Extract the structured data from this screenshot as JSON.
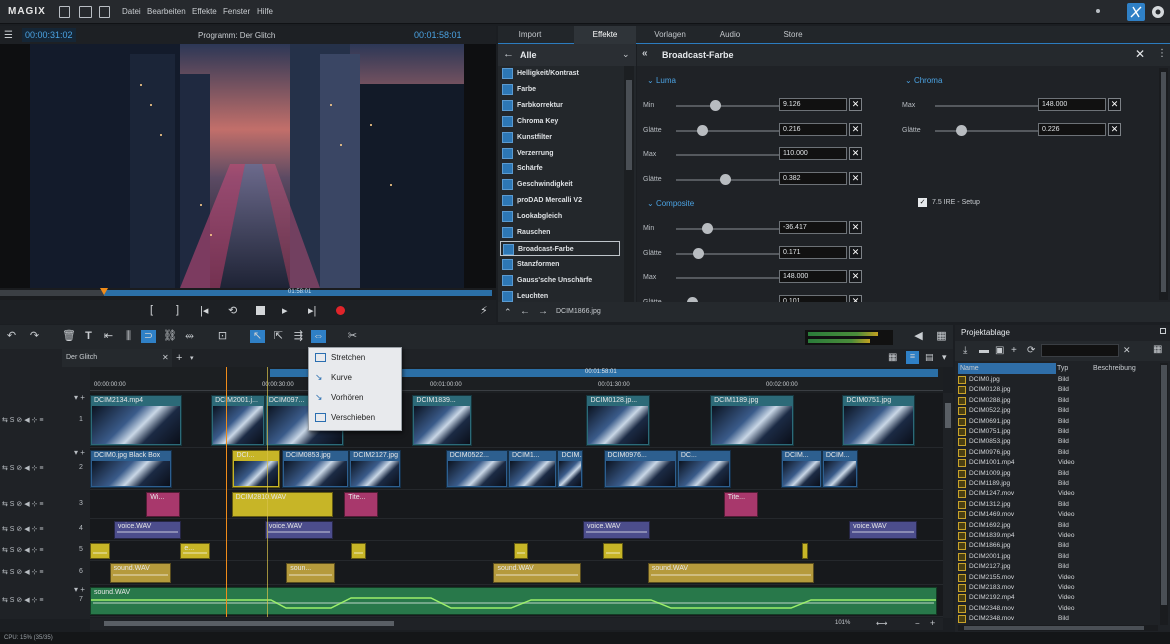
{
  "app": {
    "logo": "MAGIX",
    "menu": [
      "Datei",
      "Bearbeiten",
      "Effekte",
      "Fenster",
      "Hilfe"
    ]
  },
  "preview": {
    "timecode_left": "00:00:31:02",
    "title": "Programm: Der Glitch",
    "timecode_right": "00:01:58:01",
    "scrub_time": "01:58:01"
  },
  "tabs": [
    {
      "label": "Import",
      "active": false
    },
    {
      "label": "Effekte",
      "active": true
    },
    {
      "label": "Vorlagen",
      "active": false
    },
    {
      "label": "Audio",
      "active": false
    },
    {
      "label": "Store",
      "active": false
    }
  ],
  "effects": {
    "category": "Alle",
    "items": [
      "Helligkeit/Kontrast",
      "Farbe",
      "Farbkorrektur",
      "Chroma Key",
      "Kunstfilter",
      "Verzerrung",
      "Schärfe",
      "Geschwindigkeit",
      "proDAD Mercalli V2",
      "Lookabgleich",
      "Rauschen",
      "Broadcast-Farbe",
      "Stanzformen",
      "Gauss'sche Unschärfe",
      "Leuchten"
    ],
    "selected_index": 11
  },
  "panel": {
    "title": "Broadcast-Farbe",
    "luma": {
      "heading": "Luma",
      "rows": [
        {
          "label": "Min",
          "value": "9.126",
          "level": 0.3
        },
        {
          "label": "Glätte",
          "value": "0.216",
          "level": 0.2
        },
        {
          "label": "Max",
          "value": "110.000",
          "level": 0.9
        },
        {
          "label": "Glätte",
          "value": "0.382",
          "level": 0.38
        }
      ]
    },
    "composite": {
      "heading": "Composite",
      "rows": [
        {
          "label": "Min",
          "value": "-36.417",
          "level": 0.24
        },
        {
          "label": "Glätte",
          "value": "0.171",
          "level": 0.17
        },
        {
          "label": "Max",
          "value": "148.000",
          "level": 0.9
        },
        {
          "label": "Glätte",
          "value": "0.101",
          "level": 0.12
        }
      ]
    },
    "chroma": {
      "heading": "Chroma",
      "rows": [
        {
          "label": "Max",
          "value": "148.000",
          "level": 0.9
        },
        {
          "label": "Glätte",
          "value": "0.226",
          "level": 0.2
        }
      ]
    },
    "ire_label": "7.5 IRE - Setup",
    "nav_file": "DCIM1866.jpg"
  },
  "timeline": {
    "tab": "Der Glitch",
    "ruler_labels": [
      "00:00:00:00",
      "00:00:30:00",
      "00:01:00:00",
      "00:01:30:00",
      "00:02:00:00"
    ],
    "ruler_marker": "00:01:58:01",
    "zoom": "101%",
    "track_numbers": [
      "1",
      "2",
      "3",
      "4",
      "5",
      "6",
      "7"
    ]
  },
  "clips": [
    {
      "track": 0,
      "label": "DCIM2134.mp4",
      "start": 0.0,
      "end": 0.108,
      "color": "#2c6a78"
    },
    {
      "track": 0,
      "label": "DCIM2001.j...",
      "start": 0.142,
      "end": 0.205,
      "color": "#2c6a78"
    },
    {
      "track": 0,
      "label": "DCIM097...",
      "start": 0.205,
      "end": 0.298,
      "color": "#2c6a78"
    },
    {
      "track": 0,
      "label": "DCIM1839...",
      "start": 0.378,
      "end": 0.448,
      "color": "#2c6a78"
    },
    {
      "track": 0,
      "label": "DCIM0128.jp...",
      "start": 0.582,
      "end": 0.657,
      "color": "#2c6a78"
    },
    {
      "track": 0,
      "label": "DCIM1189.jpg",
      "start": 0.727,
      "end": 0.825,
      "color": "#2c6a78"
    },
    {
      "track": 0,
      "label": "DCIM0751.jpg",
      "start": 0.882,
      "end": 0.967,
      "color": "#2c6a78"
    },
    {
      "track": 1,
      "label": "DCIM0.jpg Black Box",
      "start": 0.0,
      "end": 0.096,
      "color": "#2d5f8f"
    },
    {
      "track": 1,
      "label": "DCI...",
      "start": 0.167,
      "end": 0.223,
      "color": "#c7b527"
    },
    {
      "track": 1,
      "label": "DCIM0853.jpg",
      "start": 0.225,
      "end": 0.304,
      "color": "#2d5f8f"
    },
    {
      "track": 1,
      "label": "DCIM2127.jpg",
      "start": 0.304,
      "end": 0.365,
      "color": "#2d5f8f"
    },
    {
      "track": 1,
      "label": "DCIM0522...",
      "start": 0.417,
      "end": 0.49,
      "color": "#2d5f8f"
    },
    {
      "track": 1,
      "label": "DCIM1...",
      "start": 0.49,
      "end": 0.548,
      "color": "#2d5f8f"
    },
    {
      "track": 1,
      "label": "DCIM...",
      "start": 0.548,
      "end": 0.578,
      "color": "#2d5f8f"
    },
    {
      "track": 1,
      "label": "DCIM0976...",
      "start": 0.602,
      "end": 0.688,
      "color": "#2d5f8f"
    },
    {
      "track": 1,
      "label": "DC...",
      "start": 0.688,
      "end": 0.752,
      "color": "#2d5f8f"
    },
    {
      "track": 1,
      "label": "DCIM...",
      "start": 0.81,
      "end": 0.858,
      "color": "#2d5f8f"
    },
    {
      "track": 1,
      "label": "DCIM...",
      "start": 0.858,
      "end": 0.9,
      "color": "#2d5f8f"
    },
    {
      "track": 2,
      "label": "Wi...",
      "start": 0.066,
      "end": 0.105,
      "color": "#a8386c"
    },
    {
      "track": 2,
      "label": "DCIM2810.WAV",
      "start": 0.166,
      "end": 0.285,
      "color": "#c7b527"
    },
    {
      "track": 2,
      "label": "Tite...",
      "start": 0.298,
      "end": 0.338,
      "color": "#a8386c"
    },
    {
      "track": 2,
      "label": "Tite...",
      "start": 0.743,
      "end": 0.783,
      "color": "#a8386c"
    },
    {
      "track": 3,
      "label": "voice.WAV",
      "start": 0.028,
      "end": 0.107,
      "color": "#4c4d8c"
    },
    {
      "track": 3,
      "label": "voice.WAV",
      "start": 0.205,
      "end": 0.285,
      "color": "#4c4d8c"
    },
    {
      "track": 3,
      "label": "voice.WAV",
      "start": 0.578,
      "end": 0.657,
      "color": "#4c4d8c"
    },
    {
      "track": 3,
      "label": "voice.WAV",
      "start": 0.89,
      "end": 0.97,
      "color": "#4c4d8c"
    },
    {
      "track": 4,
      "label": "",
      "start": 0.0,
      "end": 0.024,
      "color": "#c7b527"
    },
    {
      "track": 4,
      "label": "e...",
      "start": 0.106,
      "end": 0.141,
      "color": "#c7b527"
    },
    {
      "track": 4,
      "label": "",
      "start": 0.306,
      "end": 0.323,
      "color": "#c7b527"
    },
    {
      "track": 4,
      "label": "",
      "start": 0.497,
      "end": 0.514,
      "color": "#c7b527"
    },
    {
      "track": 4,
      "label": "",
      "start": 0.601,
      "end": 0.625,
      "color": "#c7b527"
    },
    {
      "track": 4,
      "label": "",
      "start": 0.835,
      "end": 0.842,
      "color": "#c7b527"
    },
    {
      "track": 5,
      "label": "sound.WAV",
      "start": 0.023,
      "end": 0.095,
      "color": "#b59a3c"
    },
    {
      "track": 5,
      "label": "soun...",
      "start": 0.23,
      "end": 0.287,
      "color": "#b59a3c"
    },
    {
      "track": 5,
      "label": "sound.WAV",
      "start": 0.473,
      "end": 0.576,
      "color": "#b59a3c"
    },
    {
      "track": 5,
      "label": "sound.WAV",
      "start": 0.654,
      "end": 0.849,
      "color": "#b59a3c"
    },
    {
      "track": 6,
      "label": "sound.WAV",
      "start": 0.0,
      "end": 0.993,
      "color": "#28784a"
    }
  ],
  "context_menu": [
    "Stretchen",
    "Kurve",
    "Vorhören",
    "Verschieben"
  ],
  "project": {
    "title": "Projektablage",
    "columns": [
      "Name",
      "Typ",
      "Beschreibung"
    ],
    "files": [
      [
        "DCIM0.jpg",
        "Bild"
      ],
      [
        "DCIM0128.jpg",
        "Bild"
      ],
      [
        "DCIM0288.jpg",
        "Bild"
      ],
      [
        "DCIM0522.jpg",
        "Bild"
      ],
      [
        "DCIM0691.jpg",
        "Bild"
      ],
      [
        "DCIM0751.jpg",
        "Bild"
      ],
      [
        "DCIM0853.jpg",
        "Bild"
      ],
      [
        "DCIM0976.jpg",
        "Bild"
      ],
      [
        "DCIM1001.mp4",
        "Video"
      ],
      [
        "DCIM1009.jpg",
        "Bild"
      ],
      [
        "DCIM1189.jpg",
        "Bild"
      ],
      [
        "DCIM1247.mov",
        "Video"
      ],
      [
        "DCIM1312.jpg",
        "Bild"
      ],
      [
        "DCIM1469.mov",
        "Video"
      ],
      [
        "DCIM1692.jpg",
        "Bild"
      ],
      [
        "DCIM1839.mp4",
        "Video"
      ],
      [
        "DCIM1866.jpg",
        "Bild"
      ],
      [
        "DCIM2001.jpg",
        "Bild"
      ],
      [
        "DCIM2127.jpg",
        "Bild"
      ],
      [
        "DCIM2155.mov",
        "Video"
      ],
      [
        "DCIM2183.mov",
        "Video"
      ],
      [
        "DCIM2192.mp4",
        "Video"
      ],
      [
        "DCIM2348.mov",
        "Video"
      ],
      [
        "DCIM2348.mov",
        "Bild"
      ]
    ]
  },
  "status": "CPU: 15% (35/35)"
}
